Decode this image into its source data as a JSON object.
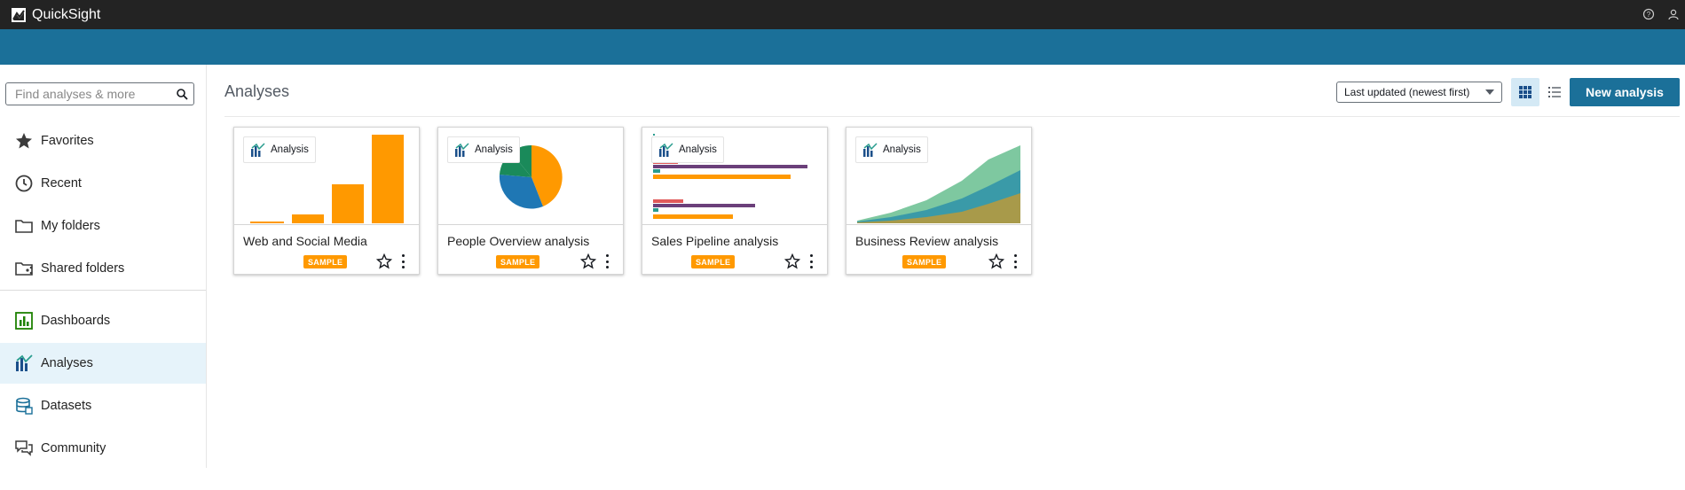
{
  "app": {
    "title": "QuickSight"
  },
  "search": {
    "placeholder": "Find analyses & more"
  },
  "sidebar": {
    "items": [
      {
        "label": "Favorites",
        "icon": "star-icon"
      },
      {
        "label": "Recent",
        "icon": "clock-icon"
      },
      {
        "label": "My folders",
        "icon": "folder-icon"
      },
      {
        "label": "Shared folders",
        "icon": "shared-folder-icon"
      },
      {
        "label": "Dashboards",
        "icon": "dashboard-icon"
      },
      {
        "label": "Analyses",
        "icon": "analysis-icon",
        "active": true
      },
      {
        "label": "Datasets",
        "icon": "dataset-icon"
      },
      {
        "label": "Community",
        "icon": "community-icon"
      }
    ]
  },
  "main": {
    "title": "Analyses",
    "sort": {
      "selected": "Last updated (newest first)"
    },
    "new_button": "New analysis"
  },
  "cards": [
    {
      "badge": "Analysis",
      "title": "Web and Social Media",
      "tag": "SAMPLE",
      "thumbnail": "bar-chart"
    },
    {
      "badge": "Analysis",
      "title": "People Overview analysis",
      "tag": "SAMPLE",
      "thumbnail": "pie-chart"
    },
    {
      "badge": "Analysis",
      "title": "Sales Pipeline analysis",
      "tag": "SAMPLE",
      "thumbnail": "horizontal-bar-chart"
    },
    {
      "badge": "Analysis",
      "title": "Business Review analysis",
      "tag": "SAMPLE",
      "thumbnail": "area-chart"
    }
  ],
  "colors": {
    "topbar": "#232323",
    "banner": "#1b7099",
    "accent": "#1b7099",
    "active_nav_bg": "#e6f3fa",
    "sample_tag": "#ff9900",
    "chart_orange": "#ff9900",
    "chart_blue": "#1f77b4",
    "chart_green": "#1a8a5a",
    "chart_purple": "#6b3f7a",
    "chart_red": "#e05a5a",
    "chart_teal": "#2a9d8f"
  }
}
